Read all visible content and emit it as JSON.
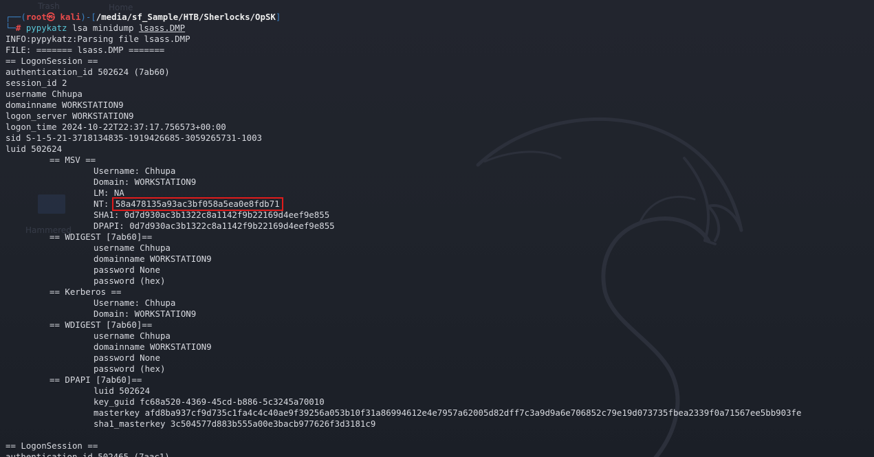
{
  "background": {
    "ghost_items": [
      "Trash",
      "Home",
      "Hammered"
    ]
  },
  "prompt": {
    "corner_top": "┌──(",
    "user": "root㉿ kali",
    "bracket_mid": ")-[",
    "path": "/media/sf_Sample/HTB/Sherlocks/OpSK",
    "bracket_end": "]",
    "corner_bottom": "└─",
    "hash": "# ",
    "command": "pypykatz",
    "args": " lsa minidump ",
    "file": "lsass.DMP"
  },
  "output": {
    "info": "INFO:pypykatz:Parsing file lsass.DMP",
    "file_header": "FILE: ======= lsass.DMP =======",
    "logon_session_header": "== LogonSession ==",
    "authentication_id": "authentication_id 502624 (7ab60)",
    "session_id": "session_id 2",
    "username": "username Chhupa",
    "domainname": "domainname WORKSTATION9",
    "logon_server": "logon_server WORKSTATION9",
    "logon_time": "logon_time 2024-10-22T22:37:17.756573+00:00",
    "sid": "sid S-1-5-21-3718134835-1919426685-3059265731-1003",
    "luid": "luid 502624",
    "msv": {
      "header": "== MSV ==",
      "username": "Username: Chhupa",
      "domain": "Domain: WORKSTATION9",
      "lm": "LM: NA",
      "nt_label": "NT: ",
      "nt_hash": "58a478135a93ac3bf058a5ea0e8fdb71",
      "sha1": "SHA1: 0d7d930ac3b1322c8a1142f9b22169d4eef9e855",
      "dpapi": "DPAPI: 0d7d930ac3b1322c8a1142f9b22169d4eef9e855"
    },
    "wdigest1": {
      "header": "== WDIGEST [7ab60]==",
      "username": "username Chhupa",
      "domainname": "domainname WORKSTATION9",
      "password": "password None",
      "password_hex": "password (hex)"
    },
    "kerberos": {
      "header": "== Kerberos ==",
      "username": "Username: Chhupa",
      "domain": "Domain: WORKSTATION9"
    },
    "wdigest2": {
      "header": "== WDIGEST [7ab60]==",
      "username": "username Chhupa",
      "domainname": "domainname WORKSTATION9",
      "password": "password None",
      "password_hex": "password (hex)"
    },
    "dpapi": {
      "header": "== DPAPI [7ab60]==",
      "luid": "luid 502624",
      "key_guid": "key_guid fc68a520-4369-45cd-b886-5c3245a70010",
      "masterkey": "masterkey afd8ba937cf9d735c1fa4c4c40ae9f39256a053b10f31a86994612e4e7957a62005d82dff7c3a9d9a6e706852c79e19d073735fbea2339f0a71567ee5bb903fe",
      "sha1_masterkey": "sha1_masterkey 3c504577d883b555a00e3bacb977626f3d3181c9"
    },
    "logon_session_header2": "== LogonSession ==",
    "authentication_id2": "authentication_id 502465 (7aac1)"
  },
  "colors": {
    "background": "#1f222b",
    "text": "#d8dae0",
    "prompt_blue": "#3b82c4",
    "prompt_red": "#e84b4b",
    "command_cyan": "#5ac8d8",
    "highlight_box": "#e11b1b"
  }
}
